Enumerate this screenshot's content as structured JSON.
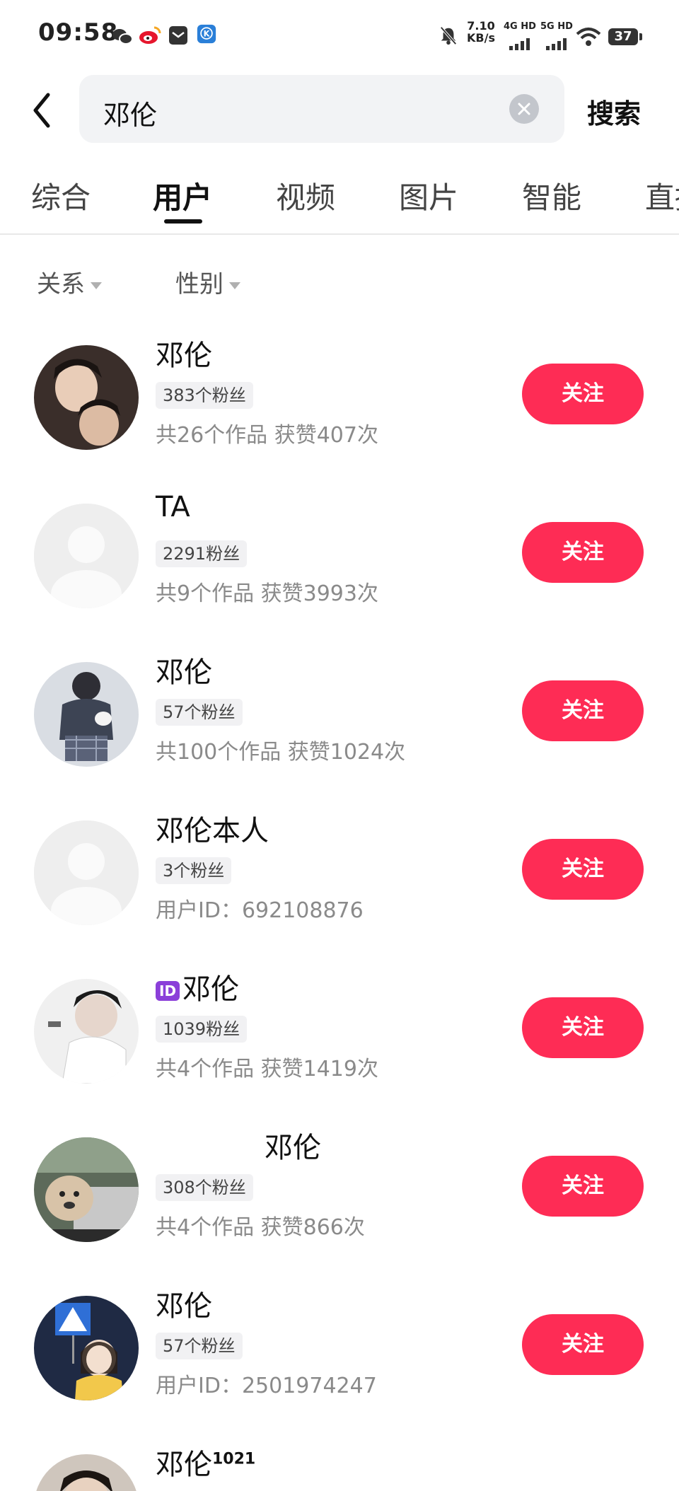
{
  "status_bar": {
    "time": "09:58",
    "speed_value": "7.10",
    "speed_unit": "KB/s",
    "net1": "4G HD",
    "net2": "5G HD",
    "battery": "37",
    "icons": [
      "wechat-icon",
      "weibo-icon",
      "mail-icon",
      "kugou-icon",
      "mute-bell-icon",
      "signal-icon",
      "wifi-icon",
      "battery-icon"
    ]
  },
  "search": {
    "query": "邓伦",
    "submit_label": "搜索"
  },
  "tabs": [
    {
      "label": "综合"
    },
    {
      "label": "用户"
    },
    {
      "label": "视频"
    },
    {
      "label": "图片"
    },
    {
      "label": "智能"
    },
    {
      "label": "直播"
    }
  ],
  "active_tab": "用户",
  "filters": [
    {
      "label": "关系"
    },
    {
      "label": "性别"
    }
  ],
  "users": [
    {
      "name": "邓伦",
      "fans": "383个粉丝",
      "stats": "共26个作品 获赞407次",
      "follow_label": "关注",
      "avatar": "photo"
    },
    {
      "name": "TA",
      "fans": "2291粉丝",
      "stats": "共9个作品 获赞3993次",
      "follow_label": "关注",
      "avatar": "default"
    },
    {
      "name": "邓伦",
      "fans": "57个粉丝",
      "stats": "共100个作品 获赞1024次",
      "follow_label": "关注",
      "avatar": "photo"
    },
    {
      "name": "邓伦本人",
      "fans": "3个粉丝",
      "stats": "用户ID：692108876",
      "follow_label": "关注",
      "avatar": "default"
    },
    {
      "name_badge": "ID",
      "name": "邓伦",
      "fans": "1039粉丝",
      "stats": "共4个作品 获赞1419次",
      "follow_label": "关注",
      "avatar": "photo"
    },
    {
      "name": "邓伦",
      "fans": "308个粉丝",
      "stats": "共4个作品 获赞866次",
      "follow_label": "关注",
      "avatar": "photo"
    },
    {
      "name": "邓伦",
      "fans": "57个粉丝",
      "stats": "用户ID：2501974247",
      "follow_label": "关注",
      "avatar": "photo"
    },
    {
      "name": "邓伦",
      "name_sup": "1021",
      "avatar": "photo"
    }
  ],
  "colors": {
    "follow_button": "#fe2c55",
    "id_badge": "#8b3fd9"
  }
}
